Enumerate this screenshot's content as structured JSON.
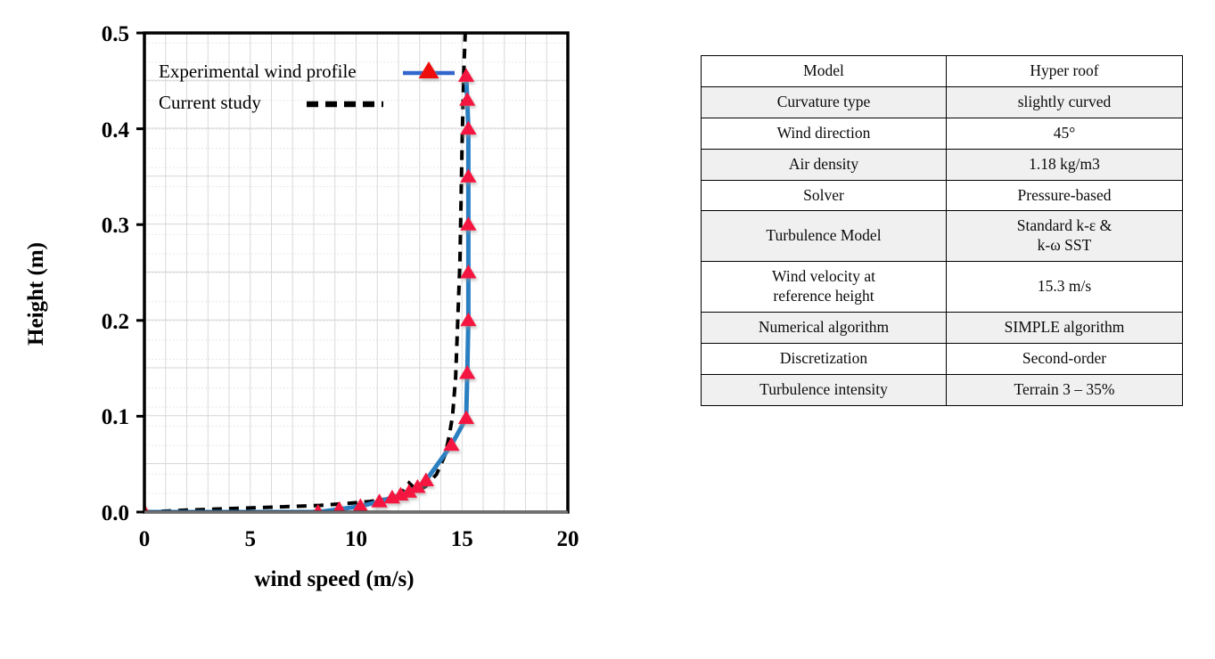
{
  "chart_data": {
    "type": "line",
    "title": "",
    "xlabel": "wind speed (m/s)",
    "ylabel": "Height (m)",
    "xlim": [
      0,
      20
    ],
    "ylim": [
      0,
      0.5
    ],
    "xticks": [
      "0",
      "5",
      "10",
      "15",
      "20"
    ],
    "yticks": [
      "0.0",
      "0.1",
      "0.2",
      "0.3",
      "0.4",
      "0.5"
    ],
    "grid": true,
    "legend_position": "top-left-inside",
    "series": [
      {
        "name": "Experimental wind profile",
        "style": "solid-line-with-triangle-markers",
        "color": "#2a7fc1",
        "marker_color": "#f4143f",
        "x": [
          0.0,
          8.2,
          9.2,
          10.2,
          11.1,
          11.7,
          12.1,
          12.5,
          12.9,
          13.3,
          14.5,
          15.2,
          15.25,
          15.3,
          15.3,
          15.3,
          15.3,
          15.3,
          15.25,
          15.2
        ],
        "y": [
          0.0,
          0.0,
          0.003,
          0.006,
          0.011,
          0.015,
          0.018,
          0.021,
          0.026,
          0.033,
          0.07,
          0.098,
          0.145,
          0.2,
          0.25,
          0.3,
          0.35,
          0.4,
          0.43,
          0.455
        ]
      },
      {
        "name": "Current study",
        "style": "dashed-line",
        "color": "#000000",
        "x": [
          0.0,
          2.0,
          4.5,
          6.5,
          8.3,
          9.6,
          10.6,
          11.4,
          12.0,
          12.5,
          12.9,
          13.3,
          13.8,
          14.2,
          14.4,
          14.55,
          14.7,
          14.8,
          14.9,
          14.95,
          15.0,
          15.05,
          15.1,
          15.15
        ],
        "y": [
          0.0,
          0.002,
          0.004,
          0.0055,
          0.007,
          0.009,
          0.011,
          0.0135,
          0.016,
          0.019,
          0.022,
          0.027,
          0.04,
          0.06,
          0.08,
          0.1,
          0.14,
          0.2,
          0.26,
          0.32,
          0.38,
          0.43,
          0.47,
          0.5
        ]
      }
    ],
    "legend": [
      {
        "label": "Experimental wind profile",
        "marker": "triangle-on-blue-line"
      },
      {
        "label": "Current study",
        "marker": "black-dashed-line"
      }
    ]
  },
  "parameters_table": {
    "rows": [
      {
        "label": "Model",
        "value": "Hyper roof"
      },
      {
        "label": "Curvature type",
        "value": "slightly curved"
      },
      {
        "label": "Wind direction",
        "value": "45°"
      },
      {
        "label": "Air density",
        "value": "1.18 kg/m3"
      },
      {
        "label": "Solver",
        "value": "Pressure-based"
      },
      {
        "label": "Turbulence Model",
        "value": "Standard k-ε &\nk-ω SST"
      },
      {
        "label": "Wind velocity at\nreference height",
        "value": "15.3 m/s"
      },
      {
        "label": "Numerical algorithm",
        "value": "SIMPLE algorithm"
      },
      {
        "label": "Discretization",
        "value": "Second-order"
      },
      {
        "label": "Turbulence intensity",
        "value": "Terrain 3 – 35%"
      }
    ]
  },
  "colors": {
    "experimental_line": "#2a7fc1",
    "marker": "#f4143f",
    "current_study_line": "#000000",
    "grid_major": "#cfcfcf",
    "grid_minor": "#ebebeb",
    "table_alt_row": "#f0f0f0",
    "axis": "#000000"
  }
}
